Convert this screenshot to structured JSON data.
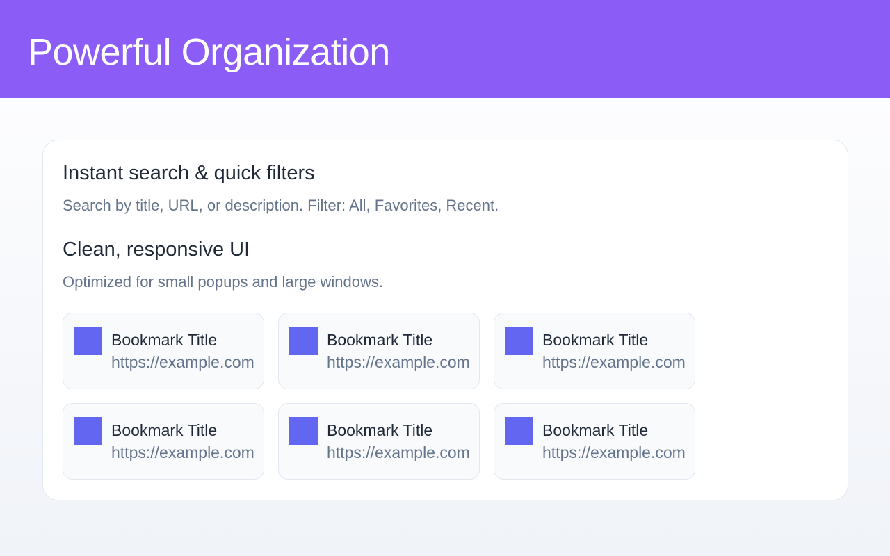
{
  "header": {
    "title": "Powerful Organization"
  },
  "features": [
    {
      "title": "Instant search & quick filters",
      "description": "Search by title, URL, or description. Filter: All, Favorites, Recent."
    },
    {
      "title": "Clean, responsive UI",
      "description": "Optimized for small popups and large windows."
    }
  ],
  "bookmarks": [
    {
      "title": "Bookmark Title",
      "url": "https://example.com"
    },
    {
      "title": "Bookmark Title",
      "url": "https://example.com"
    },
    {
      "title": "Bookmark Title",
      "url": "https://example.com"
    },
    {
      "title": "Bookmark Title",
      "url": "https://example.com"
    },
    {
      "title": "Bookmark Title",
      "url": "https://example.com"
    },
    {
      "title": "Bookmark Title",
      "url": "https://example.com"
    }
  ],
  "colors": {
    "header_bg": "#8b5cf6",
    "thumb": "#6366f1",
    "text_primary": "#1f2937",
    "text_secondary": "#64748b"
  }
}
